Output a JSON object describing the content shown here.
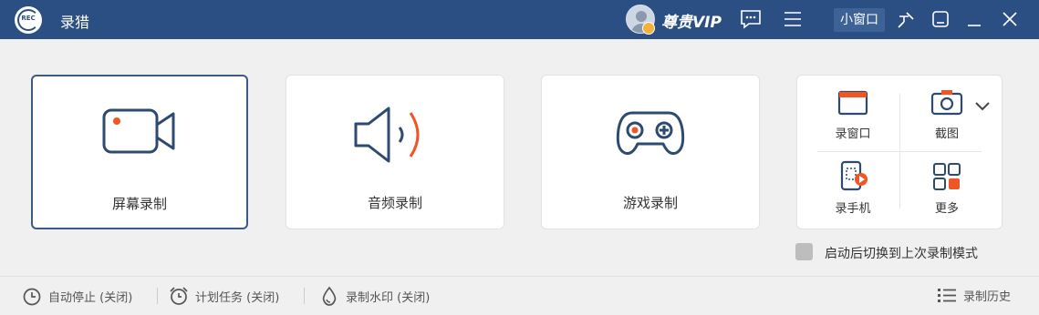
{
  "titlebar": {
    "logo_text": "REC",
    "app_title": "录猎",
    "vip_label": "尊贵VIP",
    "mini_window_label": "小窗口"
  },
  "modes": [
    {
      "label": "屏幕录制",
      "selected": true
    },
    {
      "label": "音频录制",
      "selected": false
    },
    {
      "label": "游戏录制",
      "selected": false
    }
  ],
  "quick_tools": {
    "record_window": "录窗口",
    "screenshot": "截图",
    "record_phone": "录手机",
    "more": "更多"
  },
  "restore_last_mode": {
    "label": "启动后切换到上次录制模式",
    "checked": false
  },
  "bottom": {
    "auto_stop": "自动停止 (关闭)",
    "scheduled_task": "计划任务 (关闭)",
    "watermark": "录制水印 (关闭)",
    "history": "录制历史"
  },
  "colors": {
    "titlebar_bg": "#2b4f82",
    "accent": "#2e4a70",
    "highlight": "#f05523"
  }
}
